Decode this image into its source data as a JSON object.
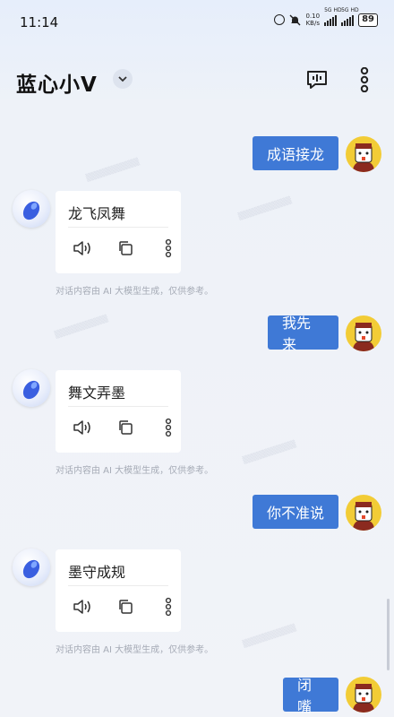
{
  "status": {
    "time": "11:14",
    "net_speed": "0.10",
    "net_unit": "KB/s",
    "sim1": "5G HD",
    "sim2": "5G HD",
    "battery": "89"
  },
  "header": {
    "title": "蓝心小V",
    "icons": [
      "chevron-down-icon",
      "voice-chat-icon",
      "more-vertical-icon"
    ]
  },
  "chat": {
    "messages": [
      {
        "role": "user",
        "text": "成语接龙"
      },
      {
        "role": "bot",
        "text": "龙飞凤舞",
        "disclaimer": "对话内容由 AI 大模型生成，仅供参考。"
      },
      {
        "role": "user",
        "text": "我先来"
      },
      {
        "role": "bot",
        "text": "舞文弄墨",
        "disclaimer": "对话内容由 AI 大模型生成，仅供参考。"
      },
      {
        "role": "user",
        "text": "你不准说"
      },
      {
        "role": "bot",
        "text": "墨守成规",
        "disclaimer": "对话内容由 AI 大模型生成，仅供参考。"
      },
      {
        "role": "user",
        "text": "闭嘴"
      }
    ],
    "action_icons": [
      "speaker-icon",
      "copy-icon",
      "more-vertical-icon"
    ]
  },
  "colors": {
    "user_bubble": "#3f79d6",
    "avatar_yellow": "#f2cc36",
    "background": "#f1f3f8"
  }
}
